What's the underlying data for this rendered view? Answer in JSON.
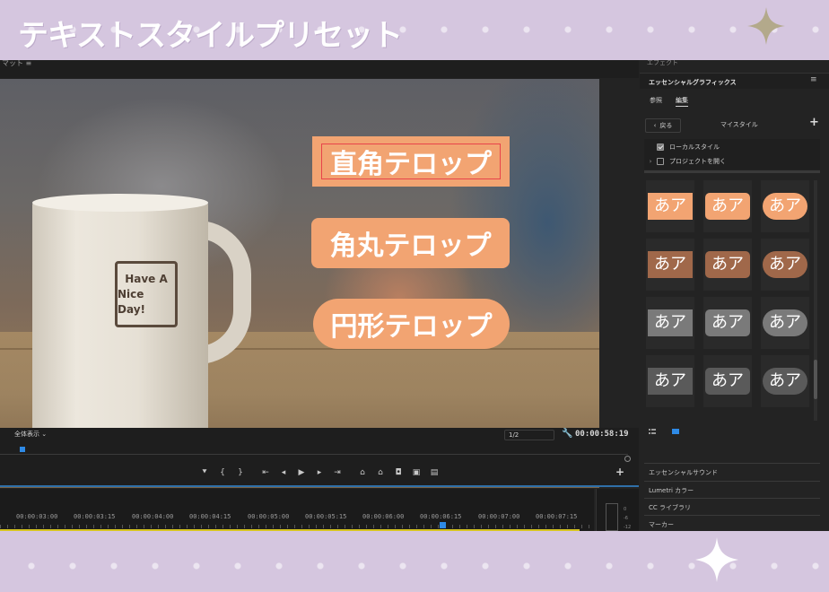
{
  "banner": {
    "title": "テキストスタイルプリセット"
  },
  "monitor": {
    "title": "マット ≡",
    "fit_label": "全体表示",
    "scale_label": "1/2",
    "timecode": "00:00:58:19",
    "mug_text_line1": "Have A",
    "mug_text_line2": "Nice Day!",
    "telops": [
      {
        "label": "直角テロップ"
      },
      {
        "label": "角丸テロップ"
      },
      {
        "label": "円形テロップ"
      }
    ],
    "transport_icons": [
      "marker-icon",
      "mark-in-icon",
      "mark-out-icon",
      "go-to-in-icon",
      "step-back-icon",
      "play-icon",
      "step-forward-icon",
      "go-to-out-icon",
      "lift-icon",
      "extract-icon",
      "export-frame-icon",
      "comparison-icon",
      "button-editor-icon"
    ],
    "add_label": "+"
  },
  "timeline": {
    "ticks": [
      "00:00:03:00",
      "00:00:03:15",
      "00:00:04:00",
      "00:00:04:15",
      "00:00:05:00",
      "00:00:05:15",
      "00:00:06:00",
      "00:00:06:15",
      "00:00:07:00",
      "00:00:07:15"
    ],
    "meter_labels": [
      "0",
      "-6",
      "-12"
    ]
  },
  "panel": {
    "effects_tab": "エフェクト",
    "title": "エッセンシャルグラフィックス",
    "menu": "≡",
    "subtabs": [
      "参照",
      "編集"
    ],
    "active_subtab": "編集",
    "back_label": "戻る",
    "mystyle_label": "マイスタイル",
    "add_label": "+",
    "local_styles": "ローカルスタイル",
    "open_project": "プロジェクトを開く",
    "swatch_text": "あア",
    "swatch_rows": [
      {
        "color": "#f2a472"
      },
      {
        "color": "#a0684a"
      },
      {
        "color": "#7a7a7a"
      },
      {
        "color": "#5a5a5a"
      }
    ],
    "sections": [
      "エッセンシャルサウンド",
      "Lumetri カラー",
      "CC ライブラリ",
      "マーカー"
    ]
  },
  "colors": {
    "telop": "#f2a472",
    "banner_bg": "#d5c6df",
    "accent_blue": "#2e8ae6"
  }
}
